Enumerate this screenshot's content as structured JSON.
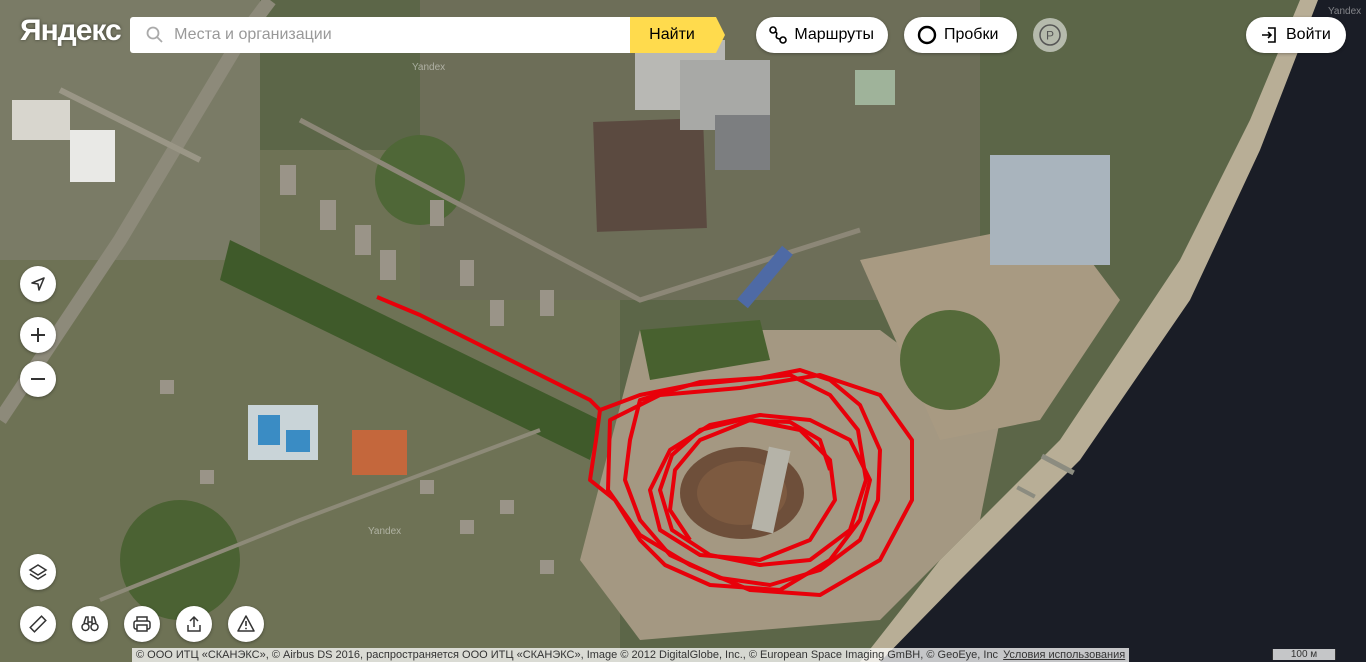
{
  "logo": "Яндекс",
  "search": {
    "placeholder": "Места и организации",
    "button": "Найти"
  },
  "toolbar": {
    "routes": "Маршруты",
    "traffic": "Пробки",
    "login": "Войти"
  },
  "map_controls": [
    "location-arrow-icon",
    "zoom-in-icon",
    "zoom-out-icon",
    "layers-icon"
  ],
  "bottom_tools": [
    "ruler-icon",
    "panorama-binoculars-icon",
    "print-icon",
    "share-icon",
    "report-error-icon"
  ],
  "watermark": "Yandex",
  "footer": {
    "copyright": "© ООО ИТЦ «СКАНЭКС», © Airbus DS 2016, распространяется ООО ИТЦ «СКАНЭКС», Image © 2012 DigitalGlobe, Inc., © European Space Imaging GmBH, © GeoEye, Inc",
    "terms": "Условия использования",
    "scale": "100 м"
  },
  "track_color": "#e8000a",
  "brand_yellow": "#ffdb4d"
}
